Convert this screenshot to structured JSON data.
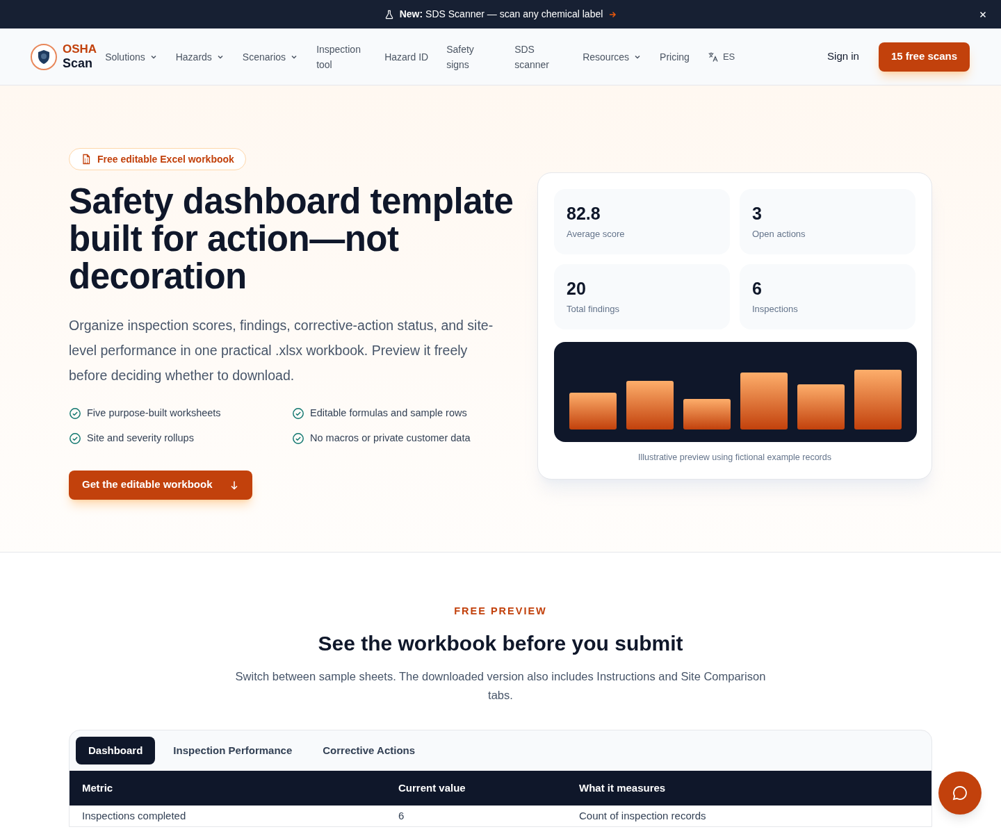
{
  "announcement": {
    "label": "New:",
    "text": "SDS Scanner — scan any chemical label"
  },
  "nav": {
    "brand": [
      "OSHA",
      "Scan"
    ],
    "items": [
      {
        "label": "Solutions",
        "dropdown": true
      },
      {
        "label": "Hazards",
        "dropdown": true
      },
      {
        "label": "Scenarios",
        "dropdown": true
      },
      {
        "label": "Inspection tool",
        "dropdown": false
      },
      {
        "label": "Hazard ID",
        "dropdown": false
      },
      {
        "label": "Safety signs",
        "dropdown": false
      },
      {
        "label": "SDS scanner",
        "dropdown": false
      },
      {
        "label": "Resources",
        "dropdown": true
      },
      {
        "label": "Pricing",
        "dropdown": false
      }
    ],
    "language": "ES",
    "sign_in": "Sign in",
    "cta": "15 free scans"
  },
  "hero": {
    "badge": "Free editable Excel workbook",
    "title": "Safety dashboard template built for action—not decoration",
    "description": "Organize inspection scores, findings, corrective-action status, and site-level performance in one practical .xlsx workbook. Preview it freely before deciding whether to download.",
    "features": [
      "Five purpose-built worksheets",
      "Editable formulas and sample rows",
      "Site and severity rollups",
      "No macros or private customer data"
    ],
    "button": "Get the editable workbook"
  },
  "preview_card": {
    "stats": [
      {
        "value": "82.8",
        "label": "Average score"
      },
      {
        "value": "3",
        "label": "Open actions"
      },
      {
        "value": "20",
        "label": "Total findings"
      },
      {
        "value": "6",
        "label": "Inspections"
      }
    ],
    "caption": "Illustrative preview using fictional example records"
  },
  "preview_section": {
    "eyebrow": "FREE PREVIEW",
    "title": "See the workbook before you submit",
    "description": "Switch between sample sheets. The downloaded version also includes Instructions and Site Comparison tabs.",
    "tabs": [
      {
        "label": "Dashboard",
        "selected": true
      },
      {
        "label": "Inspection Performance",
        "selected": false
      },
      {
        "label": "Corrective Actions",
        "selected": false
      }
    ],
    "table": {
      "columns": [
        "Metric",
        "Current value",
        "What it measures"
      ],
      "rows": [
        [
          "Inspections completed",
          "6",
          "Count of inspection records"
        ]
      ]
    }
  }
}
